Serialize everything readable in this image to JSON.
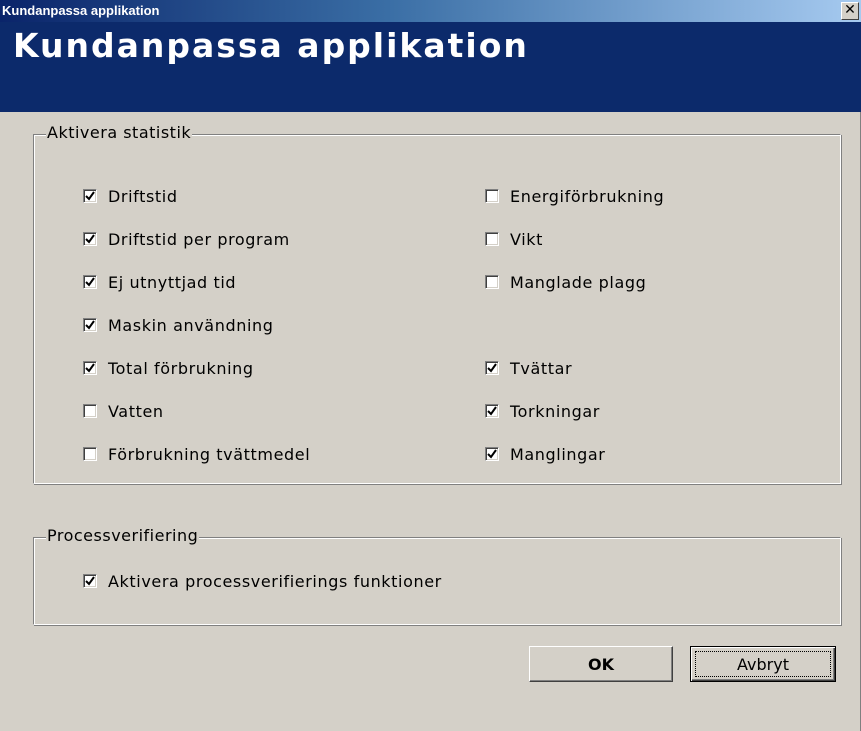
{
  "window": {
    "title": "Kundanpassa applikation",
    "close_glyph": "✕"
  },
  "header": {
    "heading": "Kundanpassa applikation"
  },
  "statistics_group": {
    "legend": "Aktivera statistik",
    "left_column": [
      {
        "label": "Driftstid",
        "checked": true
      },
      {
        "label": "Driftstid per program",
        "checked": true
      },
      {
        "label": "Ej utnyttjad tid",
        "checked": true
      },
      {
        "label": "Maskin användning",
        "checked": true
      },
      {
        "label": "Total förbrukning",
        "checked": true
      },
      {
        "label": "Vatten",
        "checked": false
      },
      {
        "label": "Förbrukning tvättmedel",
        "checked": false
      }
    ],
    "right_column": [
      {
        "label": "Energiförbrukning",
        "checked": false
      },
      {
        "label": "Vikt",
        "checked": false
      },
      {
        "label": "Manglade plagg",
        "checked": false
      },
      {
        "label": "Tvättar",
        "checked": true
      },
      {
        "label": "Torkningar",
        "checked": true
      },
      {
        "label": "Manglingar",
        "checked": true
      }
    ]
  },
  "process_group": {
    "legend": "Processverifiering",
    "item": {
      "label": "Aktivera processverifierings funktioner",
      "checked": true
    }
  },
  "buttons": {
    "ok_label": "OK",
    "cancel_label": "Avbryt"
  },
  "colors": {
    "banner": "#0c2a6b",
    "dialog_bg": "#d4d0c8",
    "title_start": "#0a246a",
    "title_end": "#a6caf0"
  },
  "icons": {
    "check": "checkmark-icon",
    "close": "close-icon"
  }
}
